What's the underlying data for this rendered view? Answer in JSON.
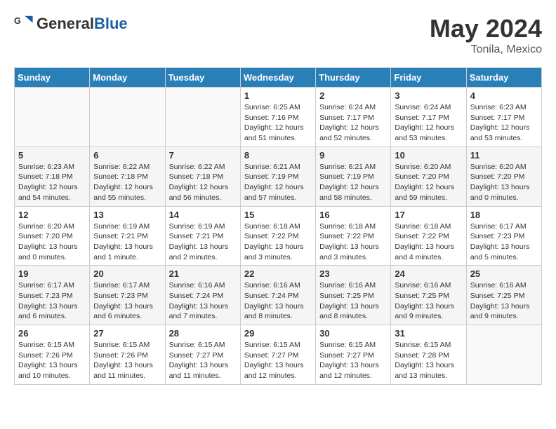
{
  "header": {
    "logo_general": "General",
    "logo_blue": "Blue",
    "month_year": "May 2024",
    "location": "Tonila, Mexico"
  },
  "days_of_week": [
    "Sunday",
    "Monday",
    "Tuesday",
    "Wednesday",
    "Thursday",
    "Friday",
    "Saturday"
  ],
  "weeks": [
    [
      {
        "day": "",
        "info": ""
      },
      {
        "day": "",
        "info": ""
      },
      {
        "day": "",
        "info": ""
      },
      {
        "day": "1",
        "info": "Sunrise: 6:25 AM\nSunset: 7:16 PM\nDaylight: 12 hours\nand 51 minutes."
      },
      {
        "day": "2",
        "info": "Sunrise: 6:24 AM\nSunset: 7:17 PM\nDaylight: 12 hours\nand 52 minutes."
      },
      {
        "day": "3",
        "info": "Sunrise: 6:24 AM\nSunset: 7:17 PM\nDaylight: 12 hours\nand 53 minutes."
      },
      {
        "day": "4",
        "info": "Sunrise: 6:23 AM\nSunset: 7:17 PM\nDaylight: 12 hours\nand 53 minutes."
      }
    ],
    [
      {
        "day": "5",
        "info": "Sunrise: 6:23 AM\nSunset: 7:18 PM\nDaylight: 12 hours\nand 54 minutes."
      },
      {
        "day": "6",
        "info": "Sunrise: 6:22 AM\nSunset: 7:18 PM\nDaylight: 12 hours\nand 55 minutes."
      },
      {
        "day": "7",
        "info": "Sunrise: 6:22 AM\nSunset: 7:18 PM\nDaylight: 12 hours\nand 56 minutes."
      },
      {
        "day": "8",
        "info": "Sunrise: 6:21 AM\nSunset: 7:19 PM\nDaylight: 12 hours\nand 57 minutes."
      },
      {
        "day": "9",
        "info": "Sunrise: 6:21 AM\nSunset: 7:19 PM\nDaylight: 12 hours\nand 58 minutes."
      },
      {
        "day": "10",
        "info": "Sunrise: 6:20 AM\nSunset: 7:20 PM\nDaylight: 12 hours\nand 59 minutes."
      },
      {
        "day": "11",
        "info": "Sunrise: 6:20 AM\nSunset: 7:20 PM\nDaylight: 13 hours\nand 0 minutes."
      }
    ],
    [
      {
        "day": "12",
        "info": "Sunrise: 6:20 AM\nSunset: 7:20 PM\nDaylight: 13 hours\nand 0 minutes."
      },
      {
        "day": "13",
        "info": "Sunrise: 6:19 AM\nSunset: 7:21 PM\nDaylight: 13 hours\nand 1 minute."
      },
      {
        "day": "14",
        "info": "Sunrise: 6:19 AM\nSunset: 7:21 PM\nDaylight: 13 hours\nand 2 minutes."
      },
      {
        "day": "15",
        "info": "Sunrise: 6:18 AM\nSunset: 7:22 PM\nDaylight: 13 hours\nand 3 minutes."
      },
      {
        "day": "16",
        "info": "Sunrise: 6:18 AM\nSunset: 7:22 PM\nDaylight: 13 hours\nand 3 minutes."
      },
      {
        "day": "17",
        "info": "Sunrise: 6:18 AM\nSunset: 7:22 PM\nDaylight: 13 hours\nand 4 minutes."
      },
      {
        "day": "18",
        "info": "Sunrise: 6:17 AM\nSunset: 7:23 PM\nDaylight: 13 hours\nand 5 minutes."
      }
    ],
    [
      {
        "day": "19",
        "info": "Sunrise: 6:17 AM\nSunset: 7:23 PM\nDaylight: 13 hours\nand 6 minutes."
      },
      {
        "day": "20",
        "info": "Sunrise: 6:17 AM\nSunset: 7:23 PM\nDaylight: 13 hours\nand 6 minutes."
      },
      {
        "day": "21",
        "info": "Sunrise: 6:16 AM\nSunset: 7:24 PM\nDaylight: 13 hours\nand 7 minutes."
      },
      {
        "day": "22",
        "info": "Sunrise: 6:16 AM\nSunset: 7:24 PM\nDaylight: 13 hours\nand 8 minutes."
      },
      {
        "day": "23",
        "info": "Sunrise: 6:16 AM\nSunset: 7:25 PM\nDaylight: 13 hours\nand 8 minutes."
      },
      {
        "day": "24",
        "info": "Sunrise: 6:16 AM\nSunset: 7:25 PM\nDaylight: 13 hours\nand 9 minutes."
      },
      {
        "day": "25",
        "info": "Sunrise: 6:16 AM\nSunset: 7:25 PM\nDaylight: 13 hours\nand 9 minutes."
      }
    ],
    [
      {
        "day": "26",
        "info": "Sunrise: 6:15 AM\nSunset: 7:26 PM\nDaylight: 13 hours\nand 10 minutes."
      },
      {
        "day": "27",
        "info": "Sunrise: 6:15 AM\nSunset: 7:26 PM\nDaylight: 13 hours\nand 11 minutes."
      },
      {
        "day": "28",
        "info": "Sunrise: 6:15 AM\nSunset: 7:27 PM\nDaylight: 13 hours\nand 11 minutes."
      },
      {
        "day": "29",
        "info": "Sunrise: 6:15 AM\nSunset: 7:27 PM\nDaylight: 13 hours\nand 12 minutes."
      },
      {
        "day": "30",
        "info": "Sunrise: 6:15 AM\nSunset: 7:27 PM\nDaylight: 13 hours\nand 12 minutes."
      },
      {
        "day": "31",
        "info": "Sunrise: 6:15 AM\nSunset: 7:28 PM\nDaylight: 13 hours\nand 13 minutes."
      },
      {
        "day": "",
        "info": ""
      }
    ]
  ]
}
